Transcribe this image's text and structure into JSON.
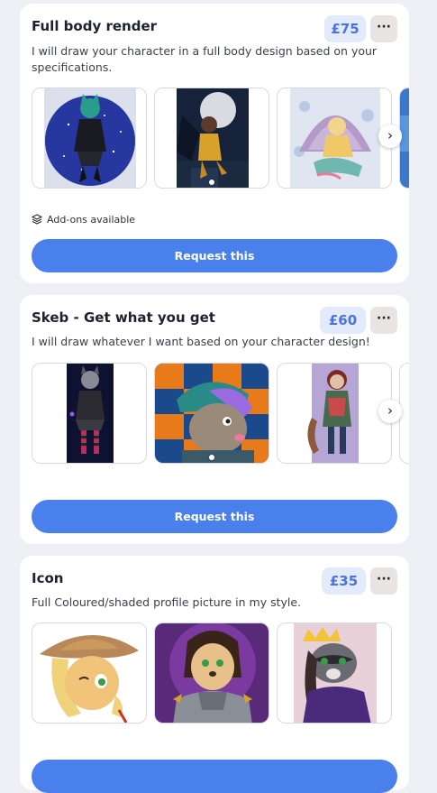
{
  "cards": [
    {
      "title": "Full body render",
      "price": "£75",
      "more_label": "···",
      "description": "I will draw your character in a full body design based on your specifications.",
      "addons_label": "Add-ons available",
      "request_label": "Request this"
    },
    {
      "title": "Skeb - Get what you get",
      "price": "£60",
      "more_label": "···",
      "description": "I will draw whatever I want based on your character design!",
      "request_label": "Request this"
    },
    {
      "title": "Icon",
      "price": "£35",
      "more_label": "···",
      "description": "Full Coloured/shaded profile picture in my style."
    }
  ],
  "icons": {
    "more": "ellipsis-icon",
    "next": "chevron-right-icon",
    "addons": "layers-icon"
  },
  "colors": {
    "accent": "#4a80ec",
    "price_bg": "#e3eafb",
    "price_text": "#4b74d8",
    "page_bg": "#eef0f6"
  }
}
